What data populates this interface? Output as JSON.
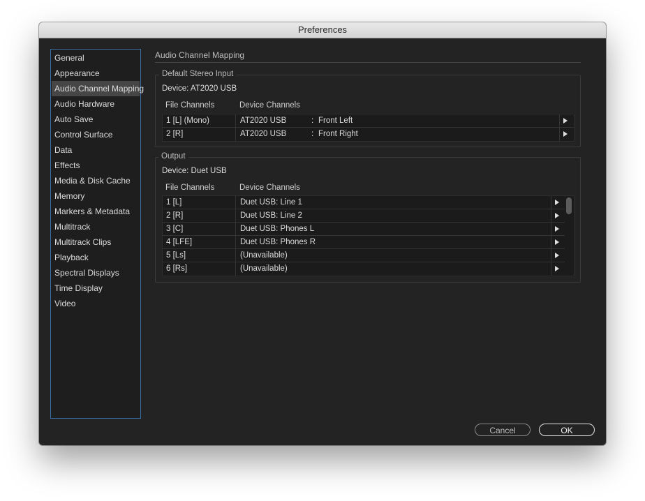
{
  "window": {
    "title": "Preferences"
  },
  "sidebar": {
    "items": [
      {
        "label": "General"
      },
      {
        "label": "Appearance"
      },
      {
        "label": "Audio Channel Mapping"
      },
      {
        "label": "Audio Hardware"
      },
      {
        "label": "Auto Save"
      },
      {
        "label": "Control Surface"
      },
      {
        "label": "Data"
      },
      {
        "label": "Effects"
      },
      {
        "label": "Media & Disk Cache"
      },
      {
        "label": "Memory"
      },
      {
        "label": "Markers & Metadata"
      },
      {
        "label": "Multitrack"
      },
      {
        "label": "Multitrack Clips"
      },
      {
        "label": "Playback"
      },
      {
        "label": "Spectral Displays"
      },
      {
        "label": "Time Display"
      },
      {
        "label": "Video"
      }
    ],
    "selected": "Audio Channel Mapping"
  },
  "panel": {
    "title": "Audio Channel Mapping",
    "stereo_input": {
      "legend": "Default Stereo Input",
      "device": "Device: AT2020 USB",
      "col_file": "File Channels",
      "col_device": "Device Channels",
      "rows": [
        {
          "file": "1 [L] (Mono)",
          "device": "AT2020 USB",
          "sep": ":",
          "channel": "Front Left"
        },
        {
          "file": "2 [R]",
          "device": "AT2020 USB",
          "sep": ":",
          "channel": "Front Right"
        }
      ]
    },
    "output": {
      "legend": "Output",
      "device": "Device: Duet USB",
      "col_file": "File Channels",
      "col_device": "Device Channels",
      "rows": [
        {
          "file": "1 [L]",
          "device": "Duet USB:  Line 1"
        },
        {
          "file": "2 [R]",
          "device": "Duet USB:  Line 2"
        },
        {
          "file": "3 [C]",
          "device": "Duet USB:  Phones L"
        },
        {
          "file": "4 [LFE]",
          "device": "Duet USB:  Phones R"
        },
        {
          "file": "5 [Ls]",
          "device": "(Unavailable)"
        },
        {
          "file": "6 [Rs]",
          "device": "(Unavailable)"
        }
      ]
    }
  },
  "buttons": {
    "cancel": "Cancel",
    "ok": "OK"
  },
  "icons": {
    "row_expand": "triangle-right-icon"
  },
  "colors": {
    "sidebar_border": "#3d6ea6",
    "selected_bg": "#464646",
    "background": "#232323"
  }
}
